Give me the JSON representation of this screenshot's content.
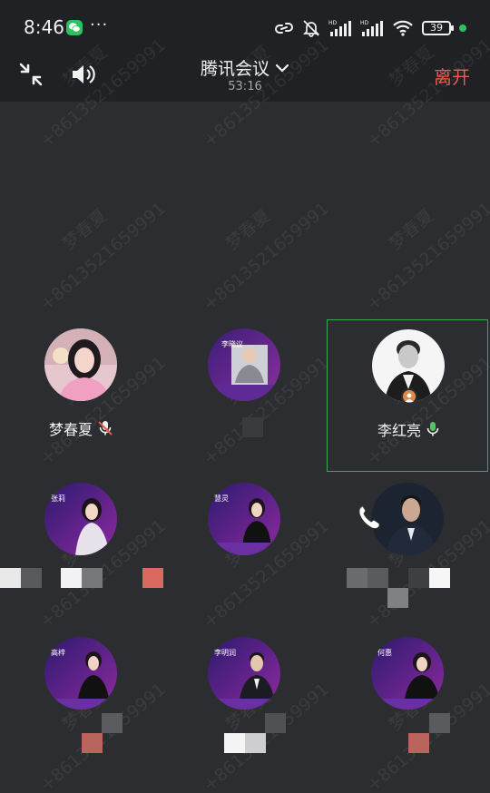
{
  "status_bar": {
    "time": "8:46",
    "dots": "···",
    "battery": "39"
  },
  "top_bar": {
    "meeting_title": "腾讯会议",
    "timer": "53:16",
    "leave_label": "离开"
  },
  "watermark": {
    "name": "梦春夏",
    "phone": "+8613521659991"
  },
  "participants": [
    {
      "name": "梦春夏",
      "mic": "muted",
      "active": false
    },
    {
      "name": "",
      "mic": "",
      "active": false
    },
    {
      "name": "李红亮",
      "mic": "on",
      "active": true
    },
    {
      "name": "",
      "mic": "",
      "active": false
    },
    {
      "name": "",
      "mic": "",
      "active": false
    },
    {
      "name": "",
      "mic": "",
      "active": false
    },
    {
      "name": "",
      "mic": "",
      "active": false
    },
    {
      "name": "",
      "mic": "",
      "active": false
    },
    {
      "name": "",
      "mic": "",
      "active": false
    }
  ],
  "poster_labels": [
    "李晓议",
    "张莉",
    "慧灵",
    "高梓",
    "李明润",
    "何惠"
  ],
  "colors": {
    "background": "#2c2d30",
    "leave": "#e65a4f",
    "active_border": "#3ea84f",
    "mic_on": "#53c463"
  }
}
